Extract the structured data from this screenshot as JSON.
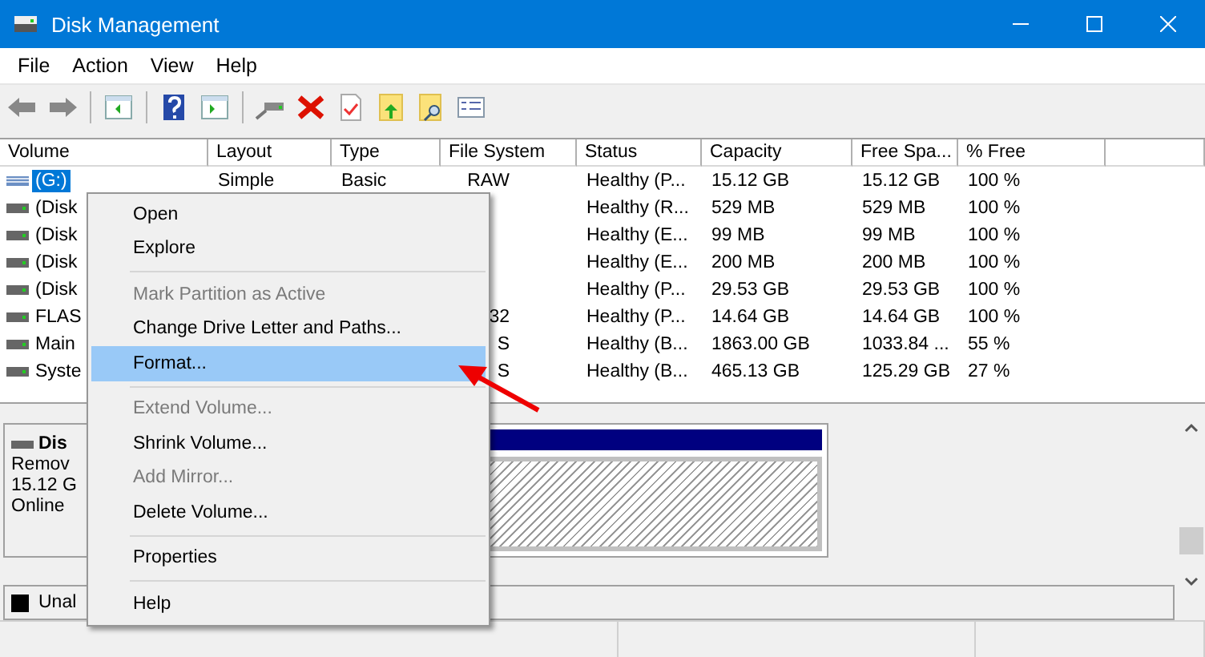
{
  "window": {
    "title": "Disk Management"
  },
  "menu_bar": [
    "File",
    "Action",
    "View",
    "Help"
  ],
  "table": {
    "columns": [
      "Volume",
      "Layout",
      "Type",
      "File System",
      "Status",
      "Capacity",
      "Free Spa...",
      "% Free"
    ],
    "rows": [
      {
        "volume": "(G:)",
        "layout": "Simple",
        "type": "Basic",
        "file_system": "RAW",
        "status": "Healthy (P...",
        "capacity": "15.12 GB",
        "free_space": "15.12 GB",
        "percent_free": "100 %",
        "selected": true,
        "kind": "removable"
      },
      {
        "volume": "(Disk",
        "status": "Healthy (R...",
        "capacity": "529 MB",
        "free_space": "529 MB",
        "percent_free": "100 %",
        "selected": false,
        "kind": "fixed"
      },
      {
        "volume": "(Disk",
        "status": "Healthy (E...",
        "capacity": "99 MB",
        "free_space": "99 MB",
        "percent_free": "100 %",
        "selected": false,
        "kind": "fixed"
      },
      {
        "volume": "(Disk",
        "status": "Healthy (E...",
        "capacity": "200 MB",
        "free_space": "200 MB",
        "percent_free": "100 %",
        "selected": false,
        "kind": "fixed"
      },
      {
        "volume": "(Disk",
        "status": "Healthy (P...",
        "capacity": "29.53 GB",
        "free_space": "29.53 GB",
        "percent_free": "100 %",
        "selected": false,
        "kind": "fixed"
      },
      {
        "volume": "FLAS",
        "file_system": "32",
        "status": "Healthy (P...",
        "capacity": "14.64 GB",
        "free_space": "14.64 GB",
        "percent_free": "100 %",
        "selected": false,
        "kind": "fixed"
      },
      {
        "volume": "Main",
        "file_system": "S",
        "status": "Healthy (B...",
        "capacity": "1863.00 GB",
        "free_space": "1033.84 ...",
        "percent_free": "55 %",
        "selected": false,
        "kind": "fixed"
      },
      {
        "volume": "Syste",
        "file_system": "S",
        "status": "Healthy (B...",
        "capacity": "465.13 GB",
        "free_space": "125.29 GB",
        "percent_free": "27 %",
        "selected": false,
        "kind": "fixed"
      }
    ]
  },
  "disk_panel": {
    "name": "Dis",
    "lines": [
      "Remov",
      "15.12 G",
      "Online"
    ]
  },
  "legend": [
    {
      "label": "Unal",
      "color": "#000000"
    }
  ],
  "context_menu": [
    {
      "kind": "item",
      "label": "Open",
      "disabled": false,
      "selected": false
    },
    {
      "kind": "item",
      "label": "Explore",
      "disabled": false,
      "selected": false
    },
    {
      "kind": "separator"
    },
    {
      "kind": "item",
      "label": "Mark Partition as Active",
      "disabled": true,
      "selected": false
    },
    {
      "kind": "item",
      "label": "Change Drive Letter and Paths...",
      "disabled": false,
      "selected": false
    },
    {
      "kind": "item",
      "label": "Format...",
      "disabled": false,
      "selected": true
    },
    {
      "kind": "separator"
    },
    {
      "kind": "item",
      "label": "Extend Volume...",
      "disabled": true,
      "selected": false
    },
    {
      "kind": "item",
      "label": "Shrink Volume...",
      "disabled": false,
      "selected": false
    },
    {
      "kind": "item",
      "label": "Add Mirror...",
      "disabled": true,
      "selected": false
    },
    {
      "kind": "item",
      "label": "Delete Volume...",
      "disabled": false,
      "selected": false
    },
    {
      "kind": "separator"
    },
    {
      "kind": "item",
      "label": "Properties",
      "disabled": false,
      "selected": false
    },
    {
      "kind": "separator"
    },
    {
      "kind": "item",
      "label": "Help",
      "disabled": false,
      "selected": false
    }
  ]
}
